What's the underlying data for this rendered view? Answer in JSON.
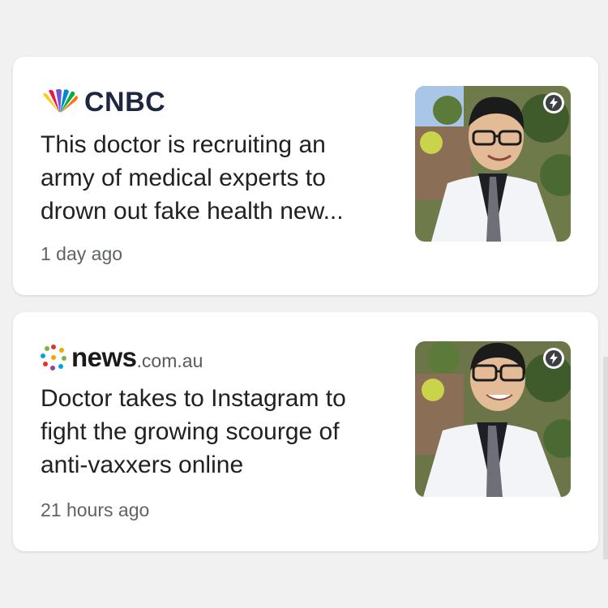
{
  "feed": {
    "cards": [
      {
        "source": {
          "name": "CNBC",
          "logo_icon": "nbc-peacock-icon",
          "colors": [
            "#fccc12",
            "#ef1541",
            "#6e55dc",
            "#0089d0",
            "#05ac3f",
            "#ff7112"
          ]
        },
        "headline": "This doctor is recruiting an army of medical experts to drown out fake health new...",
        "headline_lines": [
          "This doctor is recruiting an",
          "army of medical experts to",
          "drown out fake health new..."
        ],
        "timestamp": "1 day ago",
        "thumbnail": {
          "subject": "doctor-portrait",
          "badge_icon": "amp-lightning-icon"
        }
      },
      {
        "source": {
          "name_main": "news",
          "name_sub": ".com.au",
          "logo_icon": "news-dots-icon",
          "colors": [
            "#e4322b",
            "#f7a600",
            "#00a2dc",
            "#7cb342",
            "#8e44ad"
          ]
        },
        "headline": "Doctor takes to Instagram to fight the growing scourge of anti-vaxxers online",
        "headline_lines": [
          "Doctor takes to Instagram to",
          "fight the growing scourge of",
          "anti-vaxxers online"
        ],
        "timestamp": "21 hours ago",
        "thumbnail": {
          "subject": "doctor-portrait",
          "badge_icon": "amp-lightning-icon"
        }
      }
    ]
  }
}
